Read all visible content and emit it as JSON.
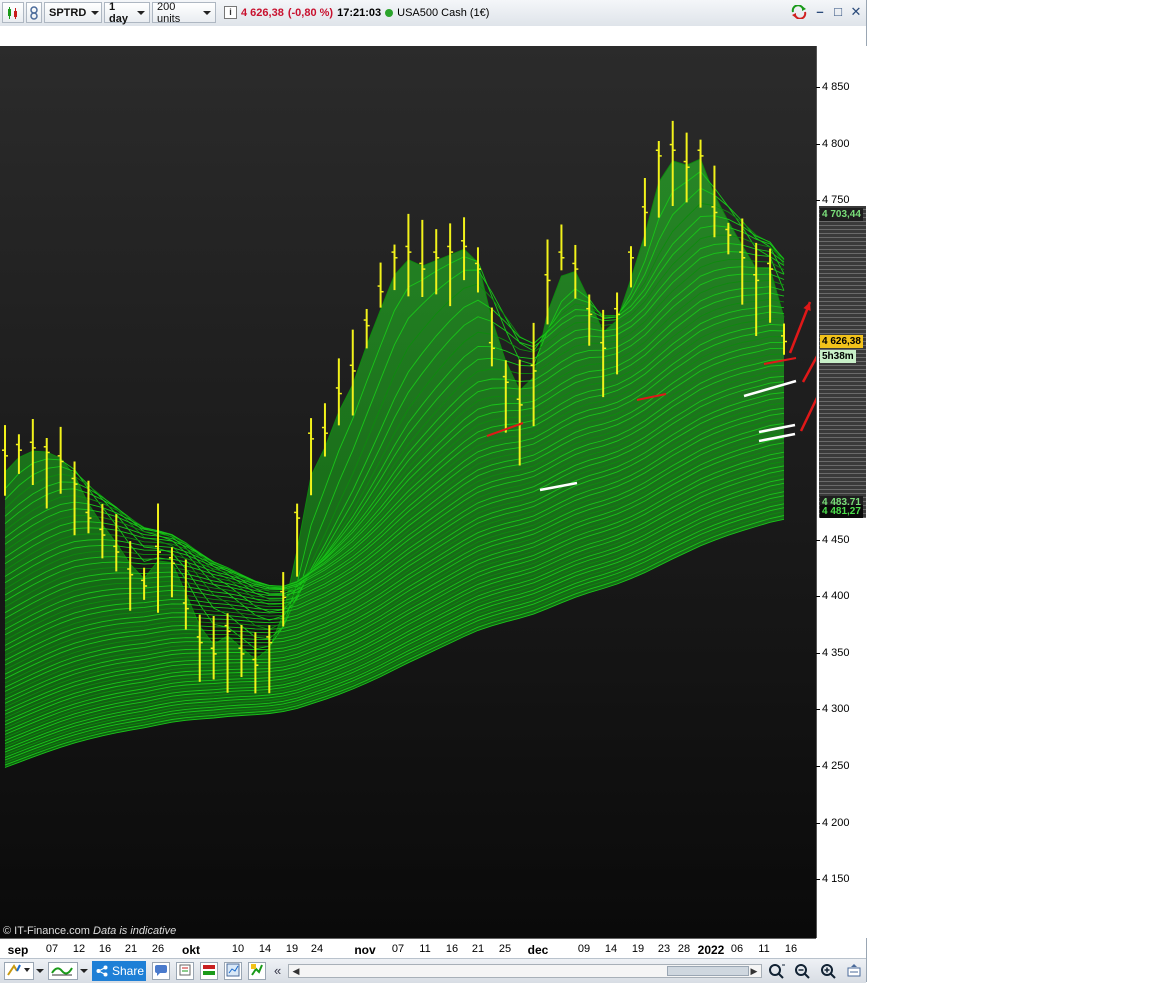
{
  "toolbar": {
    "symbol": "SPTRD",
    "timeframe": "1 day",
    "units": "200 units",
    "last_price": "4 626,38",
    "change": "(-0,80 %)",
    "time": "17:21:03",
    "instrument": "USA500 Cash (1€)"
  },
  "window_buttons": {
    "minimize": "–",
    "maximize": "□",
    "close": "✕"
  },
  "chart": {
    "credit": "© IT-Finance.com",
    "disclaimer": "Data is indicative",
    "current_price_tag": "4 626,38",
    "countdown_tag": "5h38m",
    "upper_tag": "4 703,44",
    "lower_tag_1": "4 483,71",
    "lower_tag_2": "4 481,27",
    "colors": {
      "background_top": "#2a2a2a",
      "background_bottom": "#0b0b0b",
      "ribbon": "#19c519",
      "bars": "#f2f21a",
      "annotation_red": "#e01818",
      "annotation_white": "#ffffff"
    }
  },
  "chart_data": {
    "type": "line",
    "title": "",
    "ylim": [
      4100,
      4880
    ],
    "yticks": [
      "4 850",
      "4 800",
      "4 750",
      "4 450",
      "4 400",
      "4 350",
      "4 300",
      "4 250",
      "4 200",
      "4 150"
    ],
    "xticks": [
      "sep",
      "07",
      "12",
      "16",
      "21",
      "26",
      "okt",
      "10",
      "14",
      "19",
      "24",
      "nov",
      "07",
      "11",
      "16",
      "21",
      "25",
      "dec",
      "09",
      "14",
      "19",
      "23",
      "28",
      "2022",
      "06",
      "11",
      "16"
    ],
    "series": [
      {
        "values": [
          4525,
          4530,
          4532,
          4528,
          4520,
          4500,
          4470,
          4455,
          4440,
          4420,
          4410,
          4440,
          4430,
          4390,
          4360,
          4350,
          4370,
          4350,
          4340,
          4360,
          4400,
          4470,
          4540,
          4545,
          4580,
          4600,
          4640,
          4670,
          4700,
          4705,
          4690,
          4700,
          4705,
          4710,
          4690,
          4620,
          4590,
          4570,
          4600,
          4680,
          4700,
          4690,
          4650,
          4620,
          4650,
          4700,
          4740,
          4790,
          4795,
          4780,
          4790,
          4740,
          4720,
          4700,
          4680,
          4690,
          4626
        ]
      }
    ]
  },
  "bottombar": {
    "share_label": "Share",
    "scroll_left": "«"
  }
}
